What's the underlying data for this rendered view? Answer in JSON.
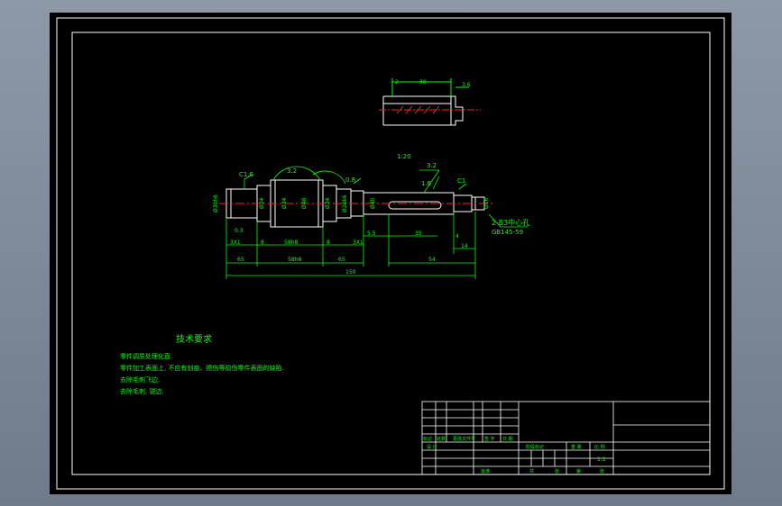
{
  "colors": {
    "frame": "#ffffff",
    "geometry": "#ffffff",
    "dimension": "#00ff00",
    "centerline": "#ff2020",
    "text": "#00ff00",
    "background": "#000000"
  },
  "key_detail": {
    "dims": {
      "d1": "2",
      "d2": "38",
      "d3": "3.6"
    }
  },
  "shaft": {
    "callouts": {
      "chamfer_left": "C1.6",
      "rough_1": "3.2",
      "rough_2": "0.8",
      "taper": "1:20",
      "rough_3": "3.2",
      "rough_4": "1.6",
      "chamfer_right": "C1"
    },
    "diameters": [
      "Ø30h6",
      "Ø24",
      "Ø34",
      "Ø48",
      "Ø34",
      "Ø28k6",
      "Ø40",
      "Ø16"
    ],
    "dims_bottom": {
      "a": "3X1",
      "b": "8",
      "c": "58h8",
      "d": "8",
      "e": "3X1",
      "f": "5.5",
      "g": "35",
      "h": "4",
      "i": "14"
    },
    "dims_overall": {
      "left": "65",
      "mid": "58h8",
      "right_a": "65",
      "right_b": "54",
      "total": "150"
    },
    "dia_note": "0.3",
    "center_hole": [
      "2-B3中心孔",
      "GB145-59"
    ]
  },
  "notes": {
    "title": "技术要求",
    "lines": [
      "零件调质处理化直.",
      "零件加工表面上, 不应有划痕、擦伤等损伤零件表面的缺陷.",
      "去除毛刺飞边.",
      "去除毛刺, 锐边."
    ]
  },
  "title_block": {
    "row_labels": [
      "标记",
      "处数",
      "更改文件号",
      "签 字",
      "日 期"
    ],
    "row2": [
      "设 计"
    ],
    "headers": [
      "阶段标记",
      "重 量",
      "比 例"
    ],
    "scale": "1:1",
    "approve": "批准",
    "bottom": [
      "共",
      "张",
      "第",
      "张"
    ]
  }
}
